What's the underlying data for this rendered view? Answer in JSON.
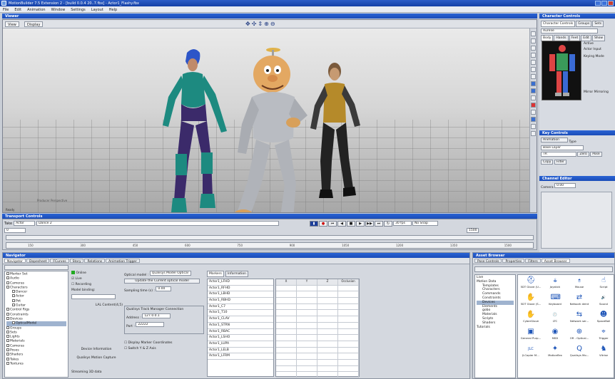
{
  "window": {
    "title": "MotionBuilder 7.5 Extension 2 - [build 0.0.4 20..7.fbx] - Actor1_Flashy.fbx"
  },
  "menu": [
    "File",
    "Edit",
    "Animation",
    "Window",
    "Settings",
    "Layout",
    "Help"
  ],
  "viewer": {
    "header": "Viewer",
    "view_btn": "View",
    "display_btn": "Display",
    "producer_label": "Producer Perspective",
    "status": "Ready"
  },
  "character_controls": {
    "header": "Character Controls",
    "tabs": [
      "Character Controls",
      "Groups",
      "Sets"
    ],
    "subtabs": [
      "Body",
      "Hands",
      "Feet",
      "Edit",
      "Show"
    ],
    "field": "Aurelie",
    "active_label": "Active",
    "actor_input": "Actor Input",
    "keying_mode": "Keying Mode",
    "mirror": "Mirror Mirroring"
  },
  "key_controls": {
    "header": "Key Controls",
    "animation_btn": "Animation",
    "type_label": "Type",
    "base_label": "Base Layer",
    "layer_value": "Base Layer",
    "tr": "TR",
    "zero": "Zero",
    "pose": "Pose",
    "copy": "Copy",
    "filter_label": "Filter"
  },
  "channel_editor": {
    "header": "Channel Editor",
    "channel": "Camera",
    "value": "0.00"
  },
  "transport": {
    "header": "Transport Controls",
    "take_label": "Take",
    "take_value": "Actor",
    "time_value": "Dance 2",
    "fps": "30 fps",
    "snap": "No Snap",
    "start": "0",
    "end": "1500",
    "ticks": [
      "150",
      "300",
      "450",
      "600",
      "750",
      "900",
      "1050",
      "1200",
      "1350",
      "1500"
    ]
  },
  "navigator": {
    "header": "Navigator",
    "tabs": [
      "Navigator",
      "Dopesheet",
      "FCurves",
      "Story",
      "Relations",
      "Animation Trigger"
    ],
    "tree": [
      {
        "label": "Marker Set",
        "level": 0
      },
      {
        "label": "Audio",
        "level": 0
      },
      {
        "label": "Cameras",
        "level": 0
      },
      {
        "label": "Characters",
        "level": 0
      },
      {
        "label": "Dancer",
        "level": 1
      },
      {
        "label": "Actor",
        "level": 1
      },
      {
        "label": "Pot",
        "level": 1
      },
      {
        "label": "Guitar",
        "level": 1
      },
      {
        "label": "Control Rigs",
        "level": 0
      },
      {
        "label": "Constraints",
        "level": 0
      },
      {
        "label": "Devices",
        "level": 0
      },
      {
        "label": "OpticalModel",
        "level": 1,
        "selected": true
      },
      {
        "label": "Groups",
        "level": 0
      },
      {
        "label": "Sets",
        "level": 0
      },
      {
        "label": "Lights",
        "level": 0
      },
      {
        "label": "Materials",
        "level": 0
      },
      {
        "label": "Cameras",
        "level": 0
      },
      {
        "label": "Poses",
        "level": 0
      },
      {
        "label": "Shaders",
        "level": 0
      },
      {
        "label": "Takes",
        "level": 0
      },
      {
        "label": "Textures",
        "level": 0
      }
    ],
    "online": "Online",
    "live": "Live",
    "recording": "Recording",
    "model_binding": "Model binding:",
    "binding_value": "LAL Content(4,5)",
    "device_info": "Device Information",
    "device_name": "Qualisys Motion Capture",
    "streaming": "Streaming 3D data",
    "optical_model_label": "Optical model :",
    "optical_model_value": "Qualisys Model Optical",
    "update_btn": "Update the Current optical model",
    "sampling_label": "Sampling time (s) :",
    "sampling_value": "0.00",
    "conn_title": "Qualisys Track Manager Connection",
    "address_label": "Address :",
    "address_value": "127.0.0.1",
    "port_label": "Port :",
    "port_value": "22222",
    "display_marker": "Display Marker Coordinates",
    "switch_yz": "Switch Y & Z Axis",
    "mkr_tabs": [
      "Markers",
      "Information"
    ],
    "markers": [
      "Actor1_LFHD",
      "Actor1_RFHD",
      "Actor1_LBHD",
      "Actor1_RBHD",
      "Actor1_C7",
      "Actor1_T10",
      "Actor1_CLAV",
      "Actor1_STRN",
      "Actor1_RBAC",
      "Actor1_LSHO",
      "Actor1_LUPA",
      "Actor1_LELB",
      "Actor1_LFRM"
    ],
    "grid_headers": [
      "X",
      "Y",
      "Z",
      "Occlusion"
    ]
  },
  "asset_browser": {
    "header": "Asset Browser",
    "tabs": [
      "Pose Controls",
      "Properties",
      "Filters",
      "Asset Browser"
    ],
    "tree": [
      "Live",
      "Motion Data",
      "Templates",
      "Characters",
      "Commands",
      "Constraints",
      "Devices",
      "Elements",
      "gobo",
      "Materials",
      "Scripts",
      "Shaders",
      "Tutorials"
    ],
    "items": [
      {
        "icon": "⛑",
        "label": "5DT Glove (U..."
      },
      {
        "icon": "🕹",
        "label": "Joystick"
      },
      {
        "icon": "🖱",
        "label": "Mouse"
      },
      {
        "icon": "☝",
        "label": "Script"
      },
      {
        "icon": "✋",
        "label": "5DT Glove (S..."
      },
      {
        "icon": "⌨",
        "label": "Keyboard"
      },
      {
        "icon": "⇄",
        "label": "Network deint"
      },
      {
        "icon": "🔊",
        "label": "Sound"
      },
      {
        "icon": "✋",
        "label": "CyberGlove"
      },
      {
        "icon": "🕐",
        "label": "LTC"
      },
      {
        "icon": "⇆",
        "label": "Network ser..."
      },
      {
        "icon": "☻",
        "label": "SpaceBall"
      },
      {
        "icon": "▣",
        "label": "General Purp..."
      },
      {
        "icon": "◉",
        "label": "MIDI"
      },
      {
        "icon": "⊕",
        "label": "OR - Optical..."
      },
      {
        "icon": "⌖",
        "label": "Trigger"
      },
      {
        "icon": "JLC",
        "label": "JLCopier M..."
      },
      {
        "icon": "✦",
        "label": "Motionflex"
      },
      {
        "icon": "Q",
        "label": "Qualisys Mo..."
      },
      {
        "icon": "♞",
        "label": "Vitrise"
      }
    ]
  }
}
